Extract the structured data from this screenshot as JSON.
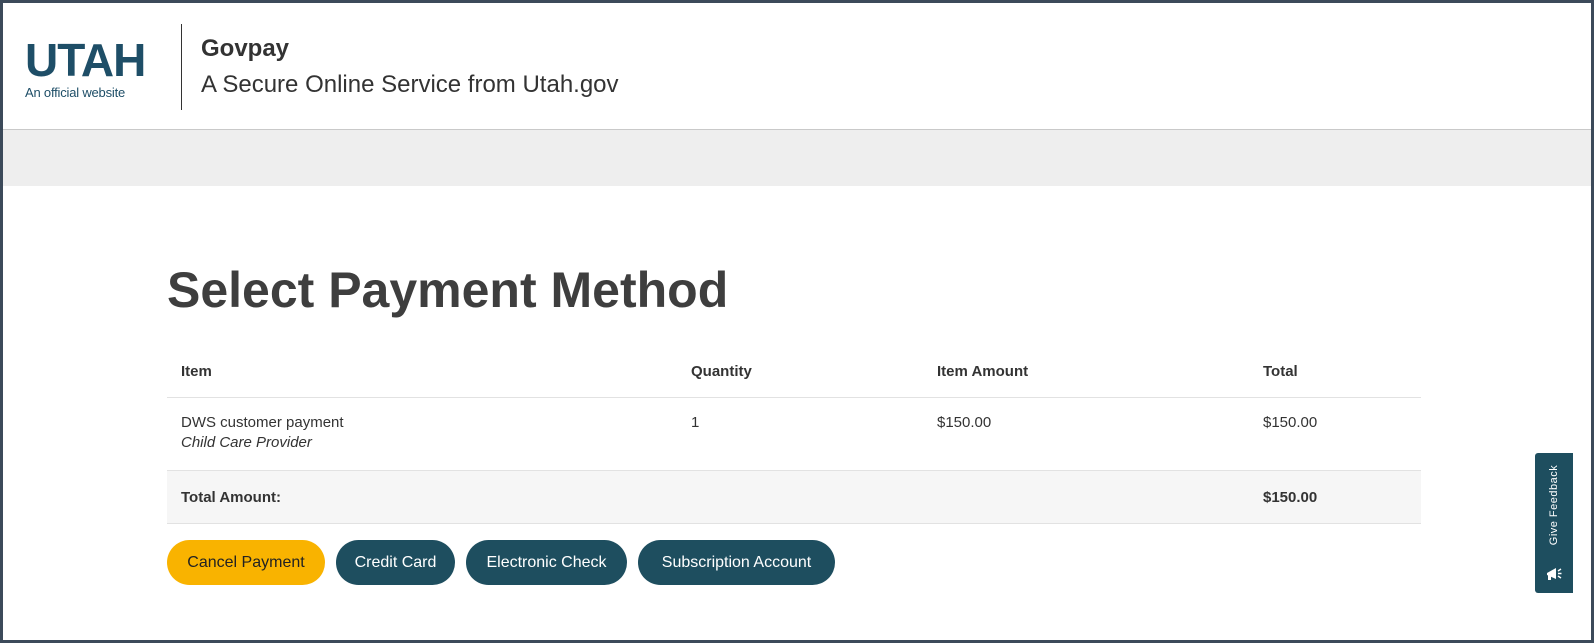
{
  "header": {
    "logo_word": "UTAH",
    "logo_sub": "An official website",
    "title": "Govpay",
    "tagline": "A Secure Online Service from Utah.gov"
  },
  "page": {
    "title": "Select Payment Method"
  },
  "table": {
    "columns": [
      "Item",
      "Quantity",
      "Item Amount",
      "Total"
    ],
    "rows": [
      {
        "item": "DWS customer payment",
        "item_sub": "Child Care Provider",
        "quantity": "1",
        "item_amount": "$150.00",
        "total": "$150.00"
      }
    ],
    "total_label": "Total Amount:",
    "total_value": "$150.00"
  },
  "buttons": {
    "cancel": "Cancel Payment",
    "credit_card": "Credit Card",
    "electronic_check": "Electronic Check",
    "subscription": "Subscription Account"
  },
  "feedback": {
    "label": "Give Feedback",
    "icon": "megaphone-icon"
  },
  "colors": {
    "brand": "#1e4e5f",
    "cancel": "#f9b300",
    "band": "#eeeeee"
  }
}
